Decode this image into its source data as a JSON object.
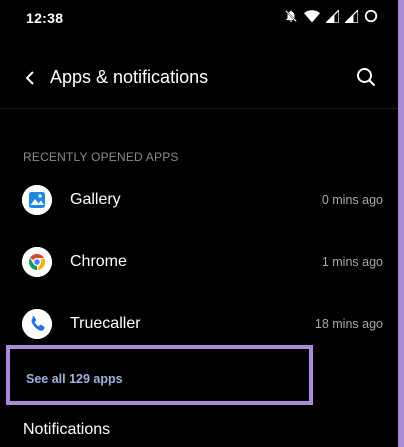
{
  "status_bar": {
    "time": "12:38",
    "icons": [
      "notifications-off-icon",
      "wifi-icon",
      "signal-icon",
      "signal-icon",
      "battery-ring-icon"
    ]
  },
  "app_bar": {
    "title": "Apps & notifications",
    "back_icon": "back-arrow-icon",
    "search_icon": "search-icon"
  },
  "section": {
    "label": "RECENTLY OPENED APPS"
  },
  "apps": [
    {
      "name": "Gallery",
      "time": "0 mins ago",
      "icon": "gallery-icon"
    },
    {
      "name": "Chrome",
      "time": "1 mins ago",
      "icon": "chrome-icon"
    },
    {
      "name": "Truecaller",
      "time": "18 mins ago",
      "icon": "phone-icon"
    }
  ],
  "see_all": "See all 129 apps",
  "notifications": "Notifications",
  "colors": {
    "background": "#000000",
    "accent_link": "#9bb3dd",
    "highlight_border": "#a98bd6",
    "secondary_text": "#a8a8a8"
  }
}
